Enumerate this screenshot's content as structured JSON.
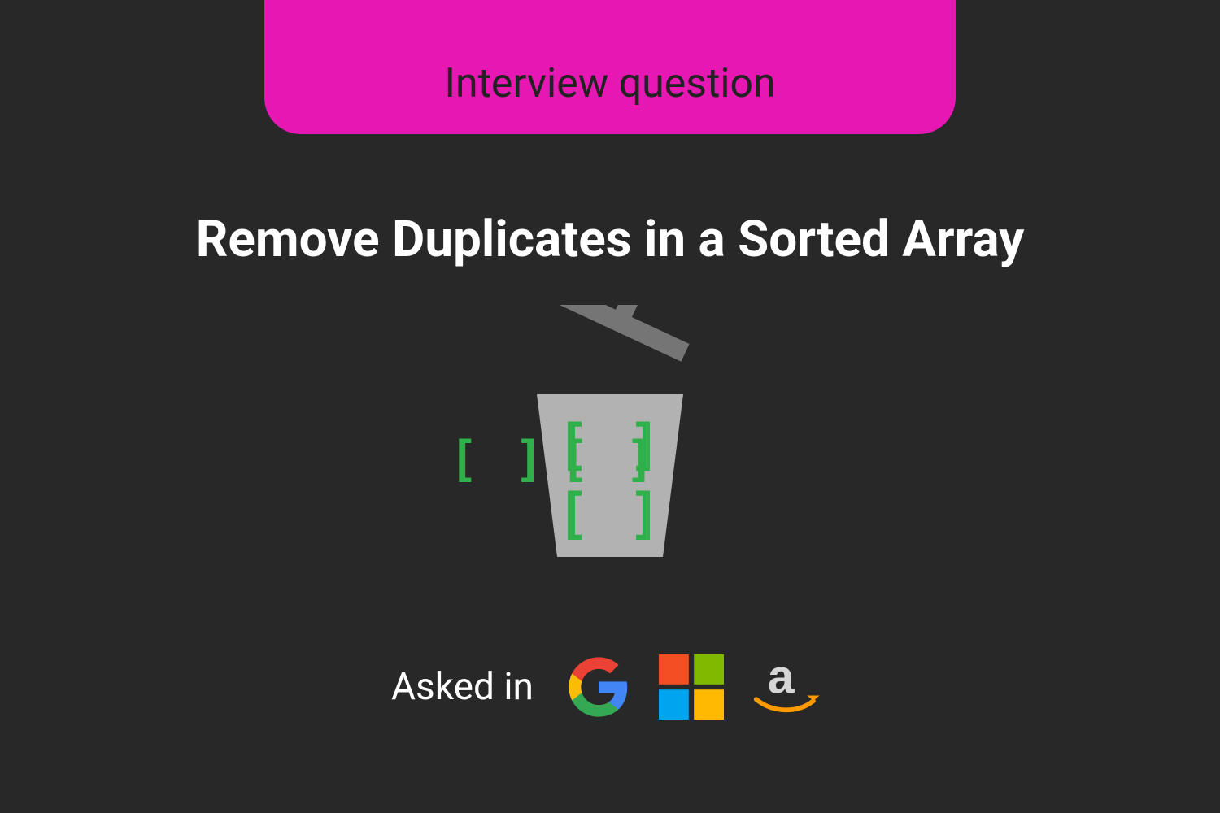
{
  "banner": {
    "label": "Interview question"
  },
  "title": "Remove Duplicates in a Sorted Array",
  "illustration": {
    "brackets_outside": [
      "[ ]",
      "[ ]"
    ],
    "brackets_inside": [
      "[ ]",
      "[ ]"
    ]
  },
  "asked_in": {
    "label": "Asked in",
    "companies": [
      "google",
      "microsoft",
      "amazon"
    ]
  },
  "colors": {
    "background": "#282828",
    "banner": "#E617B2",
    "bracket_green": "#30B04A",
    "trash_grey": "#B2B2B2",
    "trash_grey_dark": "#757575"
  }
}
